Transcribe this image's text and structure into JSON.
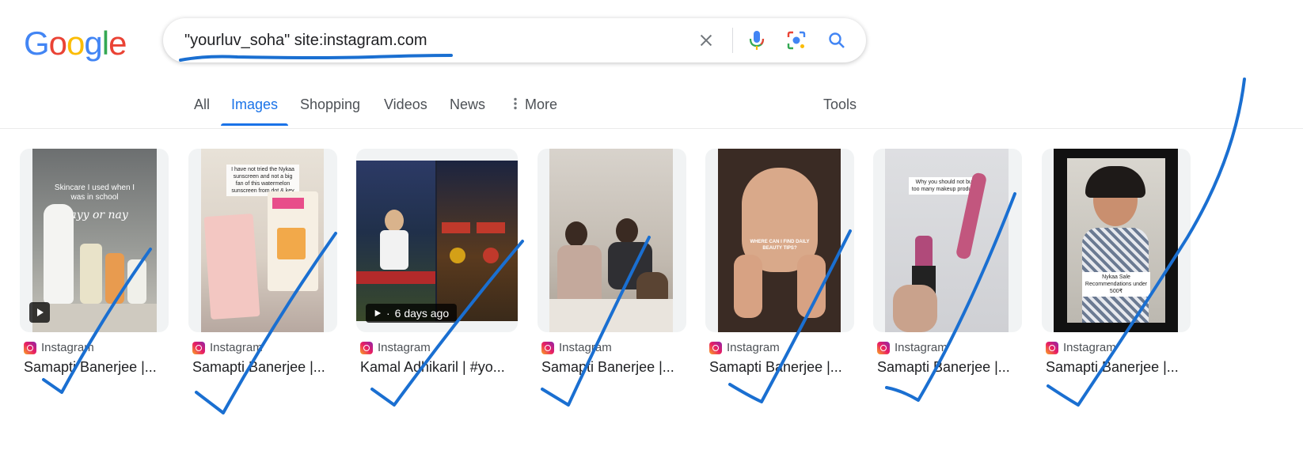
{
  "logo": {
    "letters": [
      "G",
      "o",
      "o",
      "g",
      "l",
      "e"
    ],
    "colors": [
      "#4285f4",
      "#ea4335",
      "#fbbc05",
      "#4285f4",
      "#34a853",
      "#ea4335"
    ]
  },
  "search": {
    "query": "\"yourluv_soha\" site:instagram.com"
  },
  "icons": {
    "clear": "close-icon",
    "mic": "mic-icon",
    "lens": "lens-icon",
    "search": "search-icon",
    "more": "more-vert-icon"
  },
  "tabs": [
    {
      "label": "All"
    },
    {
      "label": "Images",
      "active": true
    },
    {
      "label": "Shopping"
    },
    {
      "label": "Videos"
    },
    {
      "label": "News"
    },
    {
      "label": "More"
    }
  ],
  "tools_label": "Tools",
  "accent_color": "#1a73e8",
  "results": [
    {
      "source": "Instagram",
      "title": "Samapti Banerjee |...",
      "thumb_text": [
        "Skincare I used when I was in school",
        "Yayy or nay"
      ],
      "video": true
    },
    {
      "source": "Instagram",
      "title": "Samapti Banerjee |...",
      "thumb_text": [
        "I have not tried the Nykaa sunscreen and not a big fan of this watermelon sunscreen from dot & key"
      ]
    },
    {
      "source": "Instagram",
      "title": "Kamal Adhikaril | #yo...",
      "badge": "6 days ago",
      "video": true
    },
    {
      "source": "Instagram",
      "title": "Samapti Banerjee |..."
    },
    {
      "source": "Instagram",
      "title": "Samapti Banerjee |...",
      "thumb_text": [
        "WHERE CAN I FIND DAILY BEAUTY TIPS?"
      ]
    },
    {
      "source": "Instagram",
      "title": "Samapti Banerjee |...",
      "thumb_text": [
        "Why you should not buy too many makeup products"
      ]
    },
    {
      "source": "Instagram",
      "title": "Samapti Banerjee |...",
      "thumb_text": [
        "Nykaa Sale Recommendations under 500₹"
      ]
    }
  ],
  "annotation_color": "#1a6fd1"
}
